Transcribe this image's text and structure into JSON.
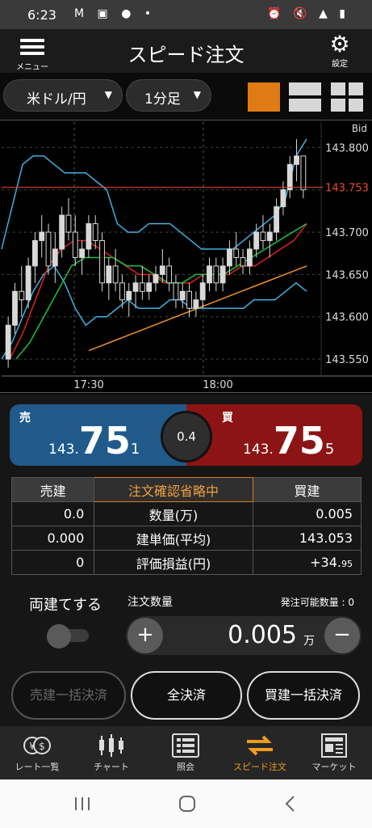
{
  "status_bar": {
    "time": "6:23",
    "left_icons": "M ▣ ● •",
    "right_icons": "⏰ 🔇 ▲ ▮"
  },
  "header": {
    "title": "スピード注文",
    "menu_label": "メニュー",
    "settings_label": "設定"
  },
  "selectors": {
    "pair": "米ドル/円",
    "timeframe": "1分足"
  },
  "chart_data": {
    "type": "candlestick",
    "price_label": "Bid",
    "y_ticks": [
      143.8,
      143.75,
      143.7,
      143.65,
      143.6,
      143.55
    ],
    "y_tick_labels": [
      "143.800",
      "143.700",
      "143.650",
      "143.600",
      "143.550"
    ],
    "x_tick_labels": [
      "17:30",
      "18:00"
    ],
    "current_price": "143.753",
    "ylim": [
      143.53,
      143.83
    ],
    "candles": [
      [
        143.55,
        143.6,
        143.54,
        143.59
      ],
      [
        143.59,
        143.64,
        143.58,
        143.63
      ],
      [
        143.63,
        143.66,
        143.6,
        143.62
      ],
      [
        143.62,
        143.67,
        143.61,
        143.66
      ],
      [
        143.66,
        143.7,
        143.64,
        143.69
      ],
      [
        143.69,
        143.72,
        143.67,
        143.7
      ],
      [
        143.7,
        143.71,
        143.65,
        143.66
      ],
      [
        143.66,
        143.7,
        143.64,
        143.68
      ],
      [
        143.68,
        143.73,
        143.67,
        143.72
      ],
      [
        143.72,
        143.74,
        143.69,
        143.7
      ],
      [
        143.7,
        143.72,
        143.66,
        143.67
      ],
      [
        143.67,
        143.69,
        143.65,
        143.68
      ],
      [
        143.68,
        143.72,
        143.67,
        143.71
      ],
      [
        143.71,
        143.72,
        143.68,
        143.69
      ],
      [
        143.69,
        143.7,
        143.63,
        143.64
      ],
      [
        143.64,
        143.67,
        143.62,
        143.66
      ],
      [
        143.66,
        143.68,
        143.63,
        143.64
      ],
      [
        143.64,
        143.65,
        143.61,
        143.62
      ],
      [
        143.62,
        143.64,
        143.6,
        143.63
      ],
      [
        143.63,
        143.65,
        143.61,
        143.64
      ],
      [
        143.64,
        143.66,
        143.62,
        143.63
      ],
      [
        143.63,
        143.65,
        143.62,
        143.64
      ],
      [
        143.64,
        143.66,
        143.63,
        143.65
      ],
      [
        143.65,
        143.68,
        143.64,
        143.66
      ],
      [
        143.66,
        143.67,
        143.63,
        143.64
      ],
      [
        143.64,
        143.65,
        143.61,
        143.62
      ],
      [
        143.62,
        143.64,
        143.61,
        143.63
      ],
      [
        143.63,
        143.64,
        143.6,
        143.61
      ],
      [
        143.61,
        143.63,
        143.6,
        143.62
      ],
      [
        143.62,
        143.65,
        143.61,
        143.64
      ],
      [
        143.64,
        143.67,
        143.63,
        143.66
      ],
      [
        143.66,
        143.67,
        143.63,
        143.64
      ],
      [
        143.64,
        143.67,
        143.63,
        143.66
      ],
      [
        143.66,
        143.69,
        143.65,
        143.68
      ],
      [
        143.68,
        143.7,
        143.66,
        143.67
      ],
      [
        143.67,
        143.68,
        143.65,
        143.66
      ],
      [
        143.66,
        143.69,
        143.65,
        143.68
      ],
      [
        143.68,
        143.71,
        143.67,
        143.7
      ],
      [
        143.7,
        143.72,
        143.68,
        143.69
      ],
      [
        143.69,
        143.71,
        143.67,
        143.7
      ],
      [
        143.7,
        143.74,
        143.69,
        143.73
      ],
      [
        143.73,
        143.76,
        143.72,
        143.75
      ],
      [
        143.75,
        143.79,
        143.74,
        143.78
      ],
      [
        143.78,
        143.81,
        143.76,
        143.79
      ],
      [
        143.79,
        143.79,
        143.74,
        143.75
      ]
    ],
    "indicators": {
      "bollinger_upper": [
        143.68,
        143.73,
        143.78,
        143.79,
        143.79,
        143.78,
        143.77,
        143.77,
        143.77,
        143.76,
        143.75,
        143.71,
        143.7,
        143.7,
        143.71,
        143.71,
        143.71,
        143.7,
        143.69,
        143.68,
        143.68,
        143.68,
        143.68,
        143.69,
        143.7,
        143.71,
        143.72,
        143.74,
        143.79,
        143.81
      ],
      "bollinger_lower": [
        143.55,
        143.57,
        143.6,
        143.63,
        143.65,
        143.66,
        143.64,
        143.61,
        143.59,
        143.6,
        143.6,
        143.61,
        143.62,
        143.61,
        143.61,
        143.61,
        143.62,
        143.62,
        143.61,
        143.61,
        143.61,
        143.61,
        143.61,
        143.61,
        143.62,
        143.62,
        143.62,
        143.63,
        143.64,
        143.63
      ],
      "ma_red": [
        143.55,
        143.58,
        143.62,
        143.66,
        143.68,
        143.69,
        143.69,
        143.68,
        143.67,
        143.66,
        143.65,
        143.65,
        143.64,
        143.64,
        143.64,
        143.65,
        143.65,
        143.65,
        143.66,
        143.66,
        143.67,
        143.68,
        143.69,
        143.71
      ],
      "ma_green": [
        143.55,
        143.57,
        143.6,
        143.63,
        143.66,
        143.67,
        143.67,
        143.67,
        143.66,
        143.66,
        143.65,
        143.64,
        143.64,
        143.65,
        143.65,
        143.65,
        143.66,
        143.67,
        143.68,
        143.69,
        143.7,
        143.71
      ],
      "ma_orange": [
        143.56,
        143.57,
        143.58,
        143.59,
        143.6,
        143.61,
        143.62,
        143.63,
        143.64,
        143.65,
        143.66
      ]
    },
    "colors": {
      "candle": "#d8d8d8",
      "bb": "#3fb0e0",
      "ma_red": "#e02020",
      "ma_green": "#20c040",
      "ma_orange": "#f0902a",
      "price_line": "#f04a2a"
    }
  },
  "quote": {
    "sell": {
      "side_label": "売",
      "prefix": "143.",
      "big": "75",
      "small": "1"
    },
    "buy": {
      "side_label": "買",
      "prefix": "143.",
      "big": "75",
      "small": "5"
    },
    "spread": "0.4"
  },
  "positions": {
    "headers": {
      "sell": "売建",
      "mid": "注文確認省略中",
      "buy": "買建"
    },
    "rows": [
      {
        "sell": "0.0",
        "label": "数量(万)",
        "buy": "0.005"
      },
      {
        "sell": "0.000",
        "label": "建単価(平均)",
        "buy": "143.053"
      },
      {
        "sell": "0",
        "label": "評価損益(円)",
        "buy": "+34.",
        "buy_small": "95"
      }
    ]
  },
  "order": {
    "hedge_label": "両建てする",
    "quantity_title": "注文数量",
    "available_label": "発注可能数量 : 0",
    "quantity": "0.005",
    "unit": "万",
    "plus": "+",
    "minus": "−"
  },
  "bulk": {
    "sell_close": "売建一括決済",
    "close_all": "全決済",
    "buy_close": "買建一括決済"
  },
  "tabs": [
    {
      "label": "レート一覧",
      "icon": "yen-dollar-icon"
    },
    {
      "label": "チャート",
      "icon": "candlestick-icon"
    },
    {
      "label": "照会",
      "icon": "list-icon"
    },
    {
      "label": "スピード注文",
      "icon": "swap-arrows-icon",
      "active": true
    },
    {
      "label": "マーケット",
      "icon": "newspaper-icon"
    }
  ],
  "theme": {
    "accent": "#e07a14",
    "sell": "#1f5a8a",
    "buy": "#8c1414"
  }
}
